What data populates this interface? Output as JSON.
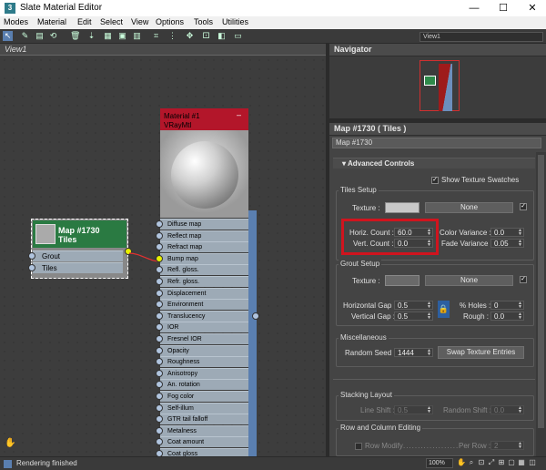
{
  "window": {
    "title": "Slate Material Editor",
    "app_icon": "3",
    "minimize": "—",
    "maximize": "☐",
    "close": "✕"
  },
  "menu": [
    "Modes",
    "Material",
    "Edit",
    "Select",
    "View",
    "Options",
    "Tools",
    "Utilities"
  ],
  "toolbar": {
    "view_select": "View1"
  },
  "view_tab": {
    "label": "View1"
  },
  "navigator": {
    "title": "Navigator"
  },
  "map_panel": {
    "header": "Map #1730  ( Tiles )",
    "name_field": "Map #1730",
    "rollout": "Advanced Controls",
    "show_texture_swatches": "Show Texture Swatches",
    "tiles_setup": {
      "title": "Tiles Setup",
      "texture_label": "Texture :",
      "texture_button": "None",
      "horiz_count_label": "Horiz. Count :",
      "horiz_count": "60.0",
      "vert_count_label": "Vert. Count :",
      "vert_count": "0.0",
      "color_variance_label": "Color Variance :",
      "color_variance": "0.0",
      "fade_variance_label": "Fade Variance :",
      "fade_variance": "0.05"
    },
    "grout_setup": {
      "title": "Grout Setup",
      "texture_label": "Texture :",
      "texture_button": "None",
      "horizontal_gap_label": "Horizontal Gap :",
      "horizontal_gap": "0.5",
      "vertical_gap_label": "Vertical Gap :",
      "vertical_gap": "0.5",
      "holes_label": "% Holes :",
      "holes": "0",
      "rough_label": "Rough :",
      "rough": "0.0"
    },
    "miscellaneous": {
      "title": "Miscellaneous",
      "random_seed_label": "Random Seed :",
      "random_seed": "1444",
      "swap_button": "Swap Texture Entries"
    },
    "stacking_layout": {
      "title": "Stacking Layout",
      "line_shift_label": "Line Shift :",
      "line_shift": "0.5",
      "random_shift_label": "Random Shift :",
      "random_shift": "0.0"
    },
    "row_column": {
      "title": "Row and Column Editing",
      "row_modify_label": "Row Modify",
      "per_row_label": "Per Row :",
      "per_row": "2"
    }
  },
  "map_node": {
    "title": "Map #1730",
    "subtitle": "Tiles",
    "slots": [
      "Grout",
      "Tiles"
    ]
  },
  "material_node": {
    "title": "Material #1",
    "subtitle": "VRayMtl",
    "slots": [
      "Diffuse map",
      "Reflect map",
      "Refract map",
      "Bump map",
      "Refl. gloss.",
      "Refr. gloss.",
      "Displacement",
      "Environment",
      "Translucency",
      "IOR",
      "Fresnel IOR",
      "Opacity",
      "Roughness",
      "Anisotropy",
      "An. rotation",
      "Fog color",
      "Self-illum",
      "GTR tail falloff",
      "Metalness",
      "Coat amount",
      "Coat gloss"
    ]
  },
  "status": {
    "text": "Rendering finished",
    "zoom": "100%"
  },
  "colors": {
    "map_node_header": "#2a7a42",
    "material_node_header": "#b3162a",
    "highlight_box": "#d0141e"
  }
}
